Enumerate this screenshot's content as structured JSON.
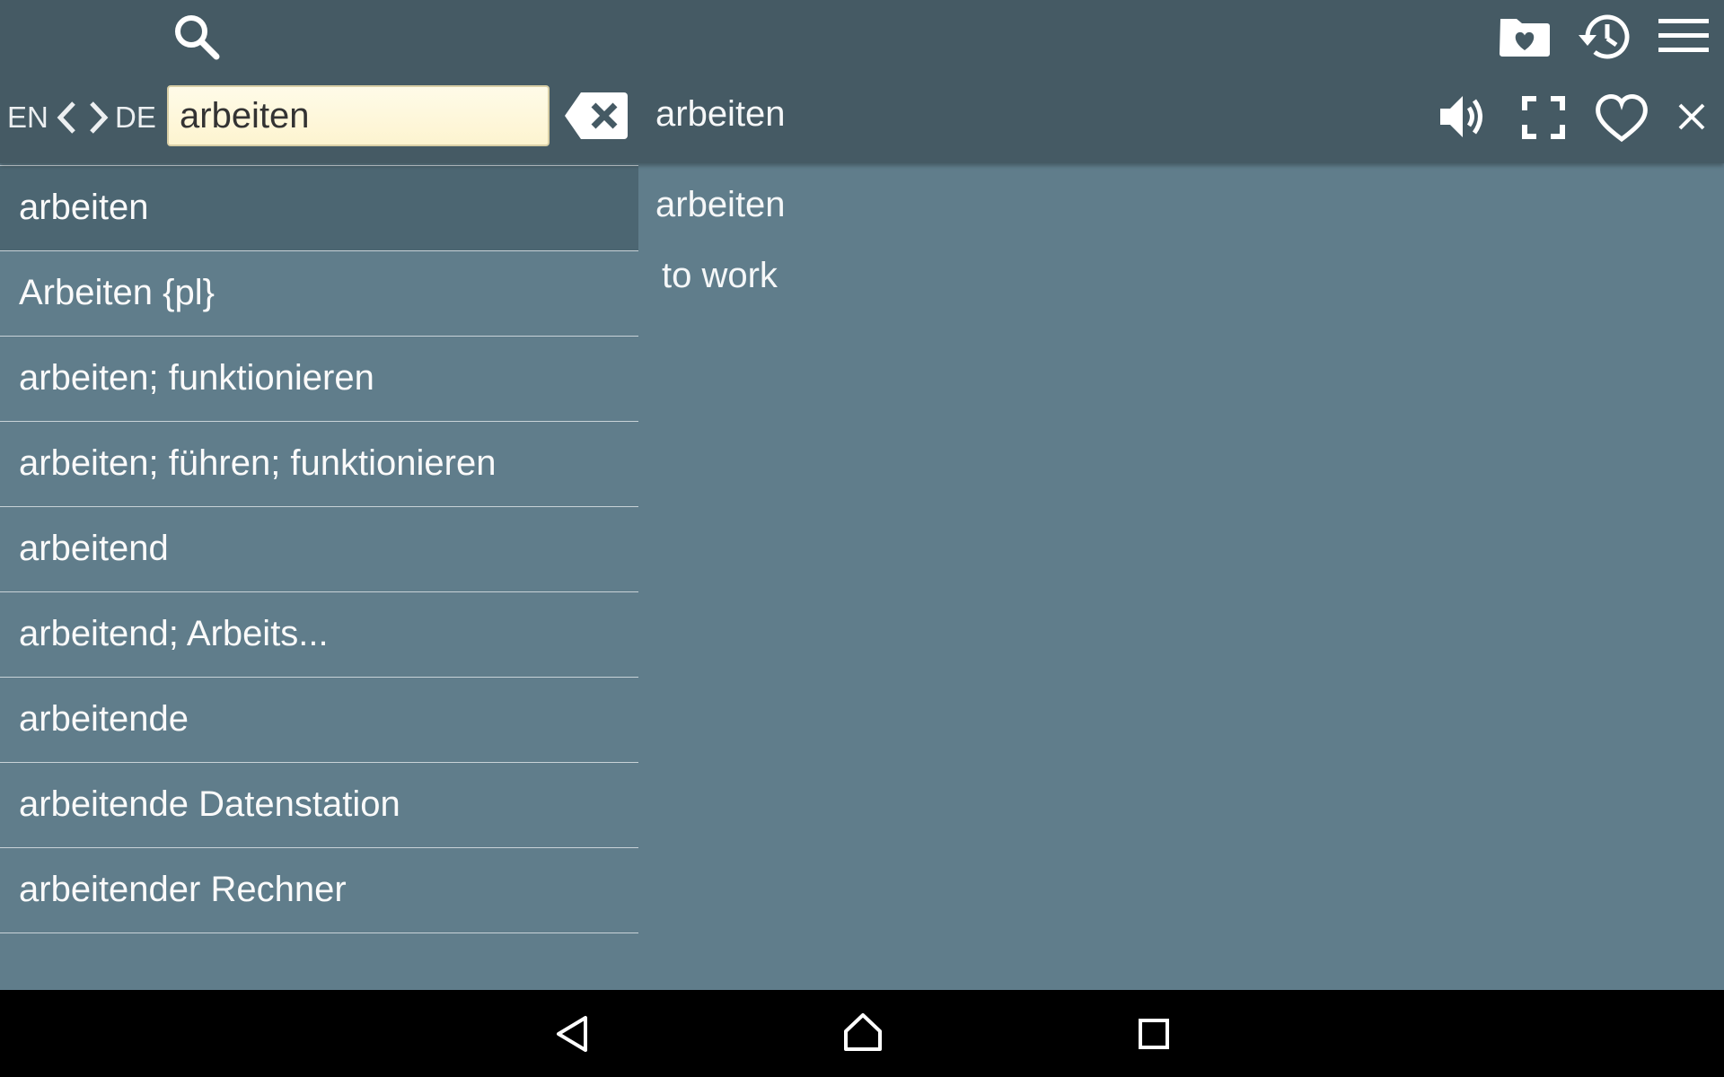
{
  "header": {
    "icons": {
      "search": "search-icon",
      "favorites_folder": "favorites-folder-icon",
      "history": "history-icon",
      "menu": "menu-icon",
      "clear": "backspace-clear-icon",
      "speaker": "speaker-icon",
      "fullscreen": "fullscreen-icon",
      "favorite": "heart-icon",
      "close": "close-icon"
    },
    "source_lang": "EN",
    "target_lang": "DE",
    "search_value": "arbeiten",
    "current_word": "arbeiten"
  },
  "results": [
    {
      "text": "arbeiten"
    },
    {
      "text": "Arbeiten {pl}"
    },
    {
      "text": "arbeiten; funktionieren"
    },
    {
      "text": "arbeiten; führen; funktionieren"
    },
    {
      "text": "arbeitend"
    },
    {
      "text": "arbeitend; Arbeits..."
    },
    {
      "text": "arbeitende"
    },
    {
      "text": "arbeitende Datenstation"
    },
    {
      "text": "arbeitender Rechner"
    }
  ],
  "definition": {
    "word": "arbeiten",
    "meaning": "to work"
  },
  "colors": {
    "header": "#455a64",
    "background": "#607d8b",
    "selected_row": "#4c6672",
    "search_bg": "#fdf6d8",
    "navbar": "#000000"
  }
}
